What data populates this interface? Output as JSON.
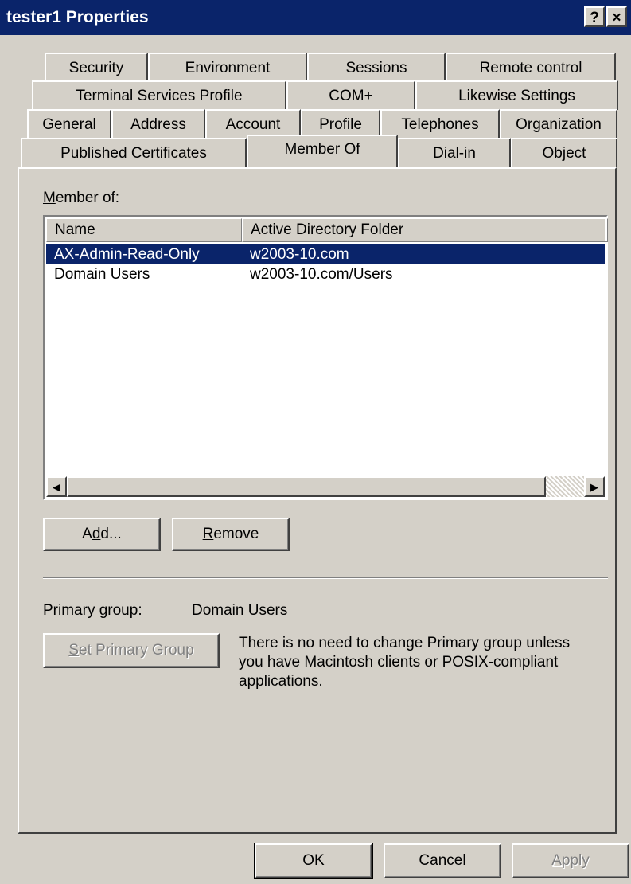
{
  "window": {
    "title": "tester1 Properties",
    "help_glyph": "?",
    "close_glyph": "×"
  },
  "tabs": {
    "row1": [
      "Security",
      "Environment",
      "Sessions",
      "Remote control"
    ],
    "row2": [
      "Terminal Services Profile",
      "COM+",
      "Likewise Settings"
    ],
    "row3": [
      "General",
      "Address",
      "Account",
      "Profile",
      "Telephones",
      "Organization"
    ],
    "row4": [
      "Published Certificates",
      "Member Of",
      "Dial-in",
      "Object"
    ],
    "selected": "Member Of"
  },
  "member_of": {
    "label_prefix": "M",
    "label_rest": "ember of:",
    "columns": [
      "Name",
      "Active Directory Folder"
    ],
    "rows": [
      {
        "name": "AX-Admin-Read-Only",
        "folder": "w2003-10.com",
        "selected": true
      },
      {
        "name": "Domain Users",
        "folder": "w2003-10.com/Users",
        "selected": false
      }
    ],
    "scroll_left_glyph": "◀",
    "scroll_right_glyph": "▶"
  },
  "buttons": {
    "add": {
      "pre": "A",
      "hot": "d",
      "post": "d..."
    },
    "remove": {
      "pre": "",
      "hot": "R",
      "post": "emove"
    },
    "set_primary": {
      "pre": "",
      "hot": "S",
      "post": "et Primary Group"
    },
    "ok": "OK",
    "cancel": "Cancel",
    "apply": {
      "pre": "",
      "hot": "A",
      "post": "pply"
    }
  },
  "primary_group": {
    "label": "Primary group:",
    "value": "Domain Users",
    "note_lines": [
      "There is no need to change Primary group unless",
      "you have Macintosh clients or POSIX-compliant",
      "applications."
    ]
  },
  "colors": {
    "face": "#d4d0c8",
    "title_bar": "#0a246a",
    "selection": "#0a246a"
  }
}
